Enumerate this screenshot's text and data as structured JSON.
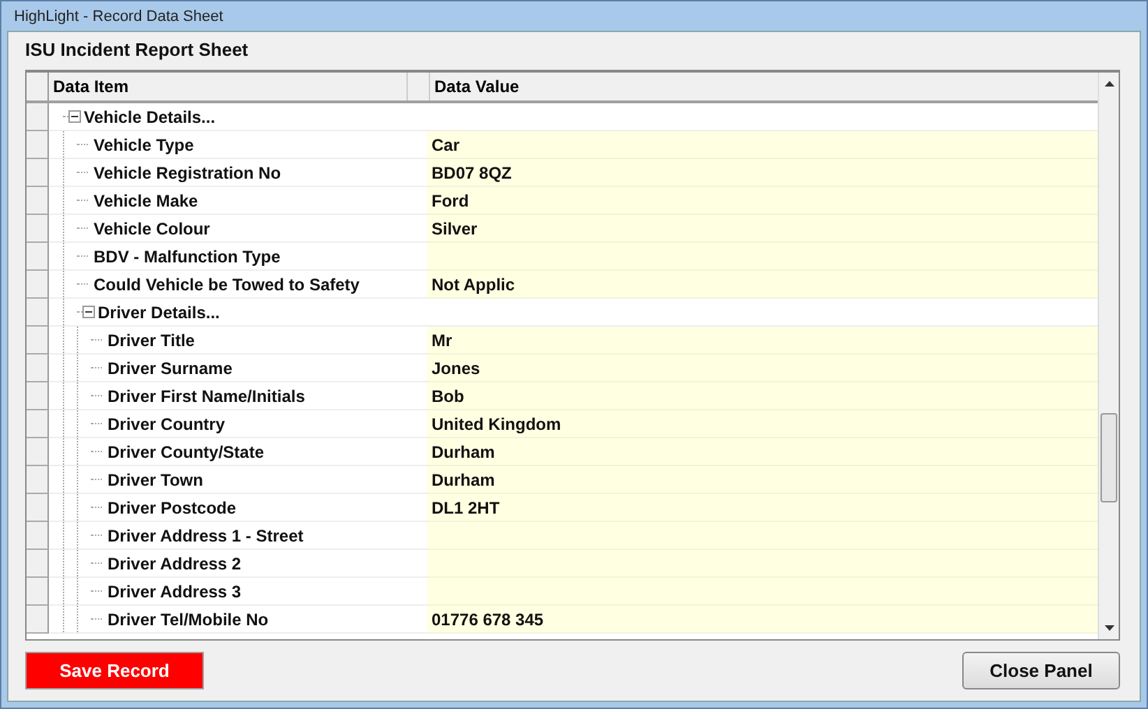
{
  "window": {
    "title": "HighLight - Record Data Sheet"
  },
  "heading": "ISU Incident Report Sheet",
  "table": {
    "columns": [
      "Data Item",
      "Data Value"
    ],
    "rows": [
      {
        "kind": "group",
        "label": "Vehicle Details...",
        "expanded": true,
        "children": [
          {
            "kind": "field",
            "label": "Vehicle Type",
            "value": "Car"
          },
          {
            "kind": "field",
            "label": "Vehicle Registration No",
            "value": "BD07 8QZ"
          },
          {
            "kind": "field",
            "label": "Vehicle Make",
            "value": "Ford"
          },
          {
            "kind": "field",
            "label": "Vehicle Colour",
            "value": "Silver"
          },
          {
            "kind": "field",
            "label": "BDV - Malfunction Type"
          },
          {
            "kind": "field",
            "label": "Could Vehicle be Towed to Safety",
            "value": "Not Applic"
          },
          {
            "kind": "group",
            "label": "Driver Details...",
            "expanded": true,
            "children": [
              {
                "kind": "field",
                "label": "Driver Title",
                "value": "Mr"
              },
              {
                "kind": "field",
                "label": "Driver Surname",
                "value": "Jones"
              },
              {
                "kind": "field",
                "label": "Driver First Name/Initials",
                "value": "Bob"
              },
              {
                "kind": "field",
                "label": "Driver Country",
                "value": "United Kingdom"
              },
              {
                "kind": "field",
                "label": "Driver County/State",
                "value": "Durham"
              },
              {
                "kind": "field",
                "label": "Driver Town",
                "value": "Durham"
              },
              {
                "kind": "field",
                "label": "Driver Postcode",
                "value": "DL1 2HT"
              },
              {
                "kind": "field",
                "label": "Driver Address 1 - Street"
              },
              {
                "kind": "field",
                "label": "Driver Address 2"
              },
              {
                "kind": "field",
                "label": "Driver Address 3"
              },
              {
                "kind": "field",
                "label": "Driver Tel/Mobile No",
                "value": "01776 678 345"
              }
            ]
          }
        ]
      }
    ]
  },
  "buttons": {
    "save": "Save Record",
    "close": "Close Panel"
  }
}
